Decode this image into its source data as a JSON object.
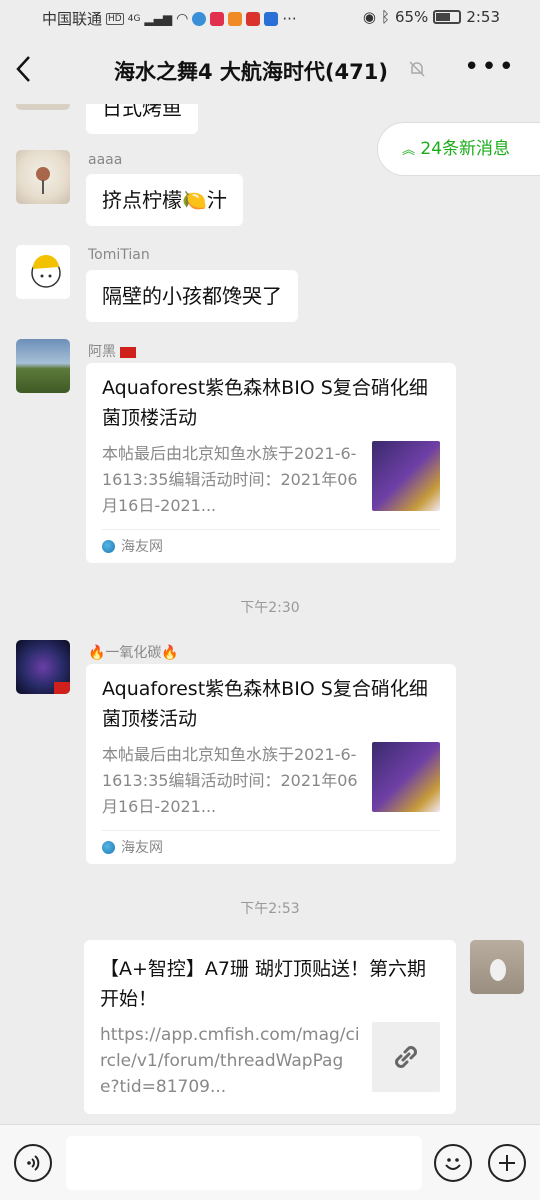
{
  "status_bar": {
    "carrier": "中国联通",
    "network": "4G",
    "battery": "65%",
    "time": "2:53"
  },
  "header": {
    "title": "海水之舞4 大航海时代(471)",
    "back_icon": "chevron-left-icon",
    "mute_icon": "bell-off-icon",
    "more_icon": "more-dots-icon",
    "more_glyph": "•••"
  },
  "new_messages": {
    "label": "24条新消息"
  },
  "messages": [
    {
      "type": "text",
      "text": "日式烤鱼"
    },
    {
      "type": "text",
      "sender": "aaaa",
      "text": "挤点柠檬🍋汁"
    },
    {
      "type": "text",
      "sender": "TomiTian",
      "text": "隔壁的小孩都馋哭了"
    },
    {
      "type": "card",
      "sender": "阿黑",
      "title": "Aquaforest紫色森林BIO S复合硝化细菌顶楼活动",
      "desc": "本帖最后由北京知鱼水族于2021-6-1613:35编辑活动时间：2021年06月16日-2021...",
      "source": "海友网"
    },
    {
      "type": "time",
      "text": "下午2:30"
    },
    {
      "type": "card",
      "sender": "🔥一氧化碳🔥",
      "title": "Aquaforest紫色森林BIO S复合硝化细菌顶楼活动",
      "desc": "本帖最后由北京知鱼水族于2021-6-1613:35编辑活动时间：2021年06月16日-2021...",
      "source": "海友网"
    },
    {
      "type": "time",
      "text": "下午2:53"
    },
    {
      "type": "link_card",
      "self": true,
      "title": "【A+智控】A7珊 瑚灯顶贴送！第六期开始！",
      "desc": "https://app.cmfish.com/mag/circle/v1/forum/threadWapPage?tid=81709...",
      "icon": "link-icon"
    }
  ],
  "bottom_bar": {
    "voice_icon": "voice-icon",
    "emoji_icon": "emoji-icon",
    "add_icon": "plus-icon"
  },
  "colors": {
    "background": "#ededed",
    "accent": "#1aad19",
    "bubble": "#ffffff"
  }
}
